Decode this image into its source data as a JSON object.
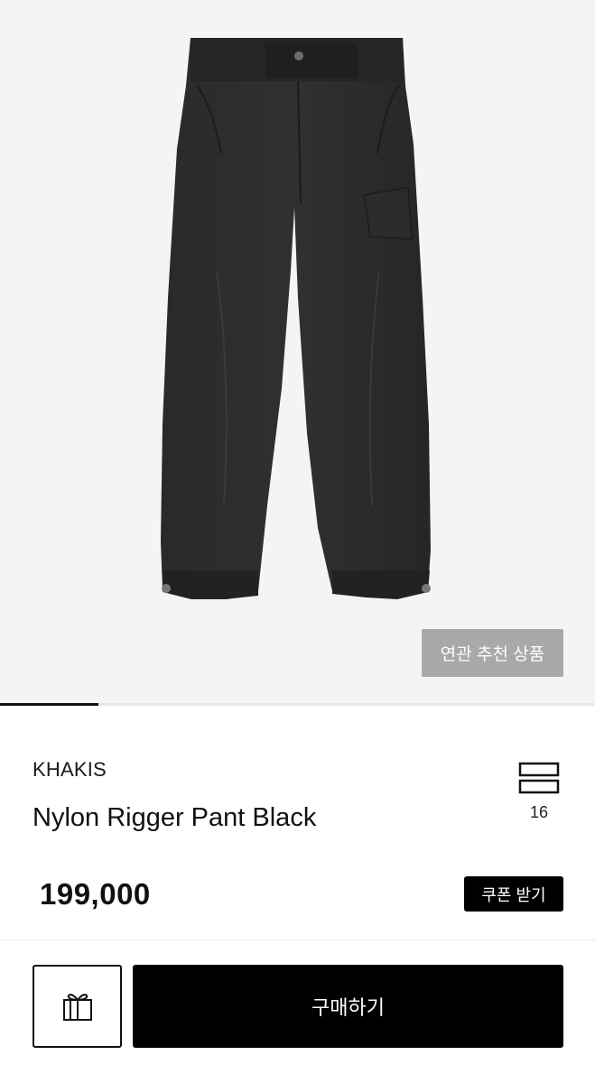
{
  "product": {
    "image_alt": "Nylon Rigger Pant Black product photo",
    "brand": "KHAKIS",
    "name": "Nylon Rigger Pant Black",
    "price": "199,000"
  },
  "gallery": {
    "related_button_label": "연관 추천 상품",
    "progress_fraction": 0.166
  },
  "list_toggle": {
    "icon": "list-layout-icon",
    "count": "16"
  },
  "coupon": {
    "label": "쿠폰 받기"
  },
  "actions": {
    "gift_icon": "gift-icon",
    "buy_label": "구매하기"
  },
  "colors": {
    "primary": "#000000",
    "hero_background": "#f4f4f4",
    "related_button": "#a9a9a9"
  }
}
